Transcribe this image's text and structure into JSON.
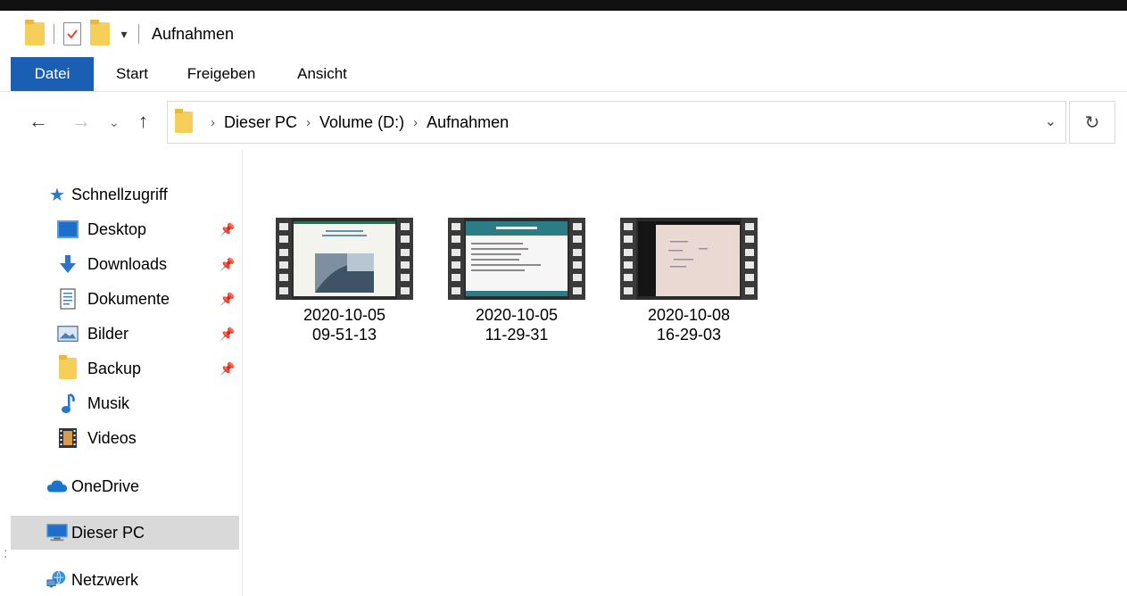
{
  "window": {
    "title": "Aufnahmen"
  },
  "ribbon": {
    "tabs": [
      {
        "label": "Datei"
      },
      {
        "label": "Start"
      },
      {
        "label": "Freigeben"
      },
      {
        "label": "Ansicht"
      }
    ]
  },
  "address": {
    "crumbs": [
      {
        "label": "Dieser PC"
      },
      {
        "label": "Volume (D:)"
      },
      {
        "label": "Aufnahmen"
      }
    ]
  },
  "nav": {
    "quick_access": "Schnellzugriff",
    "items": [
      {
        "label": "Desktop",
        "pinned": true,
        "icon": "desktop-icon"
      },
      {
        "label": "Downloads",
        "pinned": true,
        "icon": "downloads-icon"
      },
      {
        "label": "Dokumente",
        "pinned": true,
        "icon": "documents-icon"
      },
      {
        "label": "Bilder",
        "pinned": true,
        "icon": "pictures-icon"
      },
      {
        "label": "Backup",
        "pinned": true,
        "icon": "folder-icon"
      },
      {
        "label": "Musik",
        "pinned": false,
        "icon": "music-icon"
      },
      {
        "label": "Videos",
        "pinned": false,
        "icon": "videos-icon"
      }
    ],
    "onedrive": "OneDrive",
    "this_pc": "Dieser PC",
    "network": "Netzwerk"
  },
  "files": [
    {
      "line1": "2020-10-05",
      "line2": "09-51-13",
      "type": "video"
    },
    {
      "line1": "2020-10-05",
      "line2": "11-29-31",
      "type": "video"
    },
    {
      "line1": "2020-10-08",
      "line2": "16-29-03",
      "type": "video"
    }
  ],
  "colors": {
    "accent": "#1a5fb4",
    "folder": "#f6cf5a",
    "selected_bg": "#d9d9d9"
  }
}
